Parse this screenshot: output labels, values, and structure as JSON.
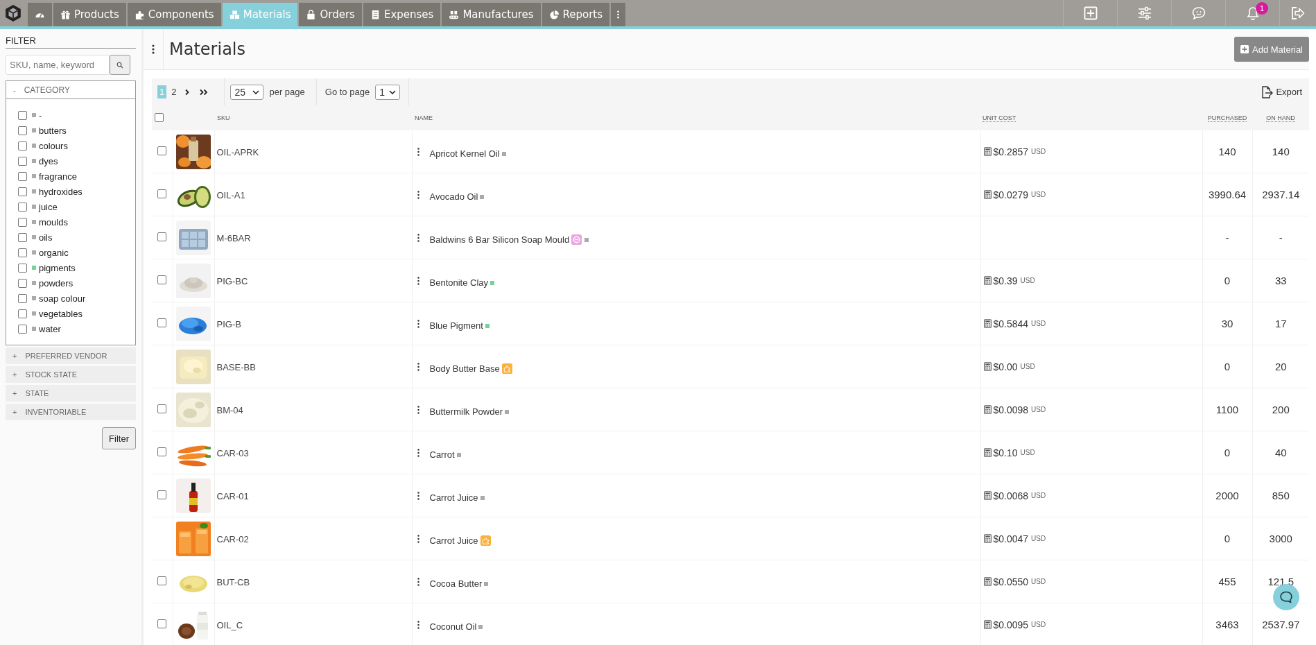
{
  "nav": {
    "dashboard_selected": false,
    "tabs": [
      {
        "label": "Products",
        "selected": false
      },
      {
        "label": "Components",
        "selected": false
      },
      {
        "label": "Materials",
        "selected": true
      },
      {
        "label": "Orders",
        "selected": false
      },
      {
        "label": "Expenses",
        "selected": false
      },
      {
        "label": "Manufactures",
        "selected": false
      },
      {
        "label": "Reports",
        "selected": false
      }
    ],
    "notifications": "1"
  },
  "filter": {
    "title": "FILTER",
    "search_placeholder": "SKU, name, keyword",
    "sections": [
      {
        "label": "CATEGORY",
        "toggle": "-",
        "expanded": true,
        "items": [
          {
            "label": "-",
            "color": "#aaaaaa",
            "checked": false
          },
          {
            "label": "butters",
            "color": "#aaaaaa",
            "checked": false
          },
          {
            "label": "colours",
            "color": "#aaaaaa",
            "checked": false
          },
          {
            "label": "dyes",
            "color": "#aaaaaa",
            "checked": false
          },
          {
            "label": "fragrance",
            "color": "#aaaaaa",
            "checked": false
          },
          {
            "label": "hydroxides",
            "color": "#aaaaaa",
            "checked": false
          },
          {
            "label": "juice",
            "color": "#aaaaaa",
            "checked": false
          },
          {
            "label": "moulds",
            "color": "#aaaaaa",
            "checked": false
          },
          {
            "label": "oils",
            "color": "#aaaaaa",
            "checked": false
          },
          {
            "label": "organic",
            "color": "#aaaaaa",
            "checked": false
          },
          {
            "label": "pigments",
            "color": "#77d09a",
            "checked": false
          },
          {
            "label": "powders",
            "color": "#aaaaaa",
            "checked": false
          },
          {
            "label": "soap colour",
            "color": "#aaaaaa",
            "checked": false
          },
          {
            "label": "vegetables",
            "color": "#aaaaaa",
            "checked": false
          },
          {
            "label": "water",
            "color": "#aaaaaa",
            "checked": false
          }
        ]
      },
      {
        "label": "PREFERRED VENDOR",
        "toggle": "+",
        "expanded": false
      },
      {
        "label": "STOCK STATE",
        "toggle": "+",
        "expanded": false
      },
      {
        "label": "STATE",
        "toggle": "+",
        "expanded": false
      },
      {
        "label": "INVENTORIABLE",
        "toggle": "+",
        "expanded": false
      }
    ],
    "button": "Filter"
  },
  "page": {
    "title": "Materials",
    "add_button": "Add Material"
  },
  "toolbar": {
    "pages": [
      {
        "label": "1",
        "selected": true
      },
      {
        "label": "2",
        "selected": false
      }
    ],
    "per_page": "25",
    "per_page_label": "per page",
    "goto_label": "Go to page",
    "goto_value": "1",
    "export": "Export"
  },
  "table": {
    "header_checked": false,
    "columns": [
      "SKU",
      "NAME",
      "UNIT COST",
      "PURCHASED",
      "ON HAND"
    ],
    "rows": [
      {
        "checked": false,
        "kind": "plain",
        "sku": "OIL-APRK",
        "name": "Apricot Kernel Oil",
        "color": "#aaaaaa",
        "cost": "$0.2857",
        "currency": "USD",
        "purchased": "140",
        "on_hand": "140"
      },
      {
        "checked": false,
        "kind": "plain",
        "sku": "OIL-A1",
        "name": "Avocado Oil",
        "color": "#aaaaaa",
        "cost": "$0.0279",
        "currency": "USD",
        "purchased": "3990.64",
        "on_hand": "2937.14"
      },
      {
        "checked": false,
        "kind": "blocked",
        "sku": "M-6BAR",
        "name": "Baldwins 6 Bar Silicon Soap Mould",
        "color": "#aaaaaa",
        "purchased": "-",
        "on_hand": "-"
      },
      {
        "checked": false,
        "kind": "plain",
        "sku": "PIG-BC",
        "name": "Bentonite Clay",
        "color": "#77d09a",
        "cost": "$0.39",
        "currency": "USD",
        "purchased": "0",
        "on_hand": "33"
      },
      {
        "checked": false,
        "kind": "plain",
        "sku": "PIG-B",
        "name": "Blue Pigment",
        "color": "#77d09a",
        "cost": "$0.5844",
        "currency": "USD",
        "purchased": "30",
        "on_hand": "17"
      },
      {
        "kind": "component",
        "sku": "BASE-BB",
        "name": "Body Butter Base",
        "cost": "$0.00",
        "currency": "USD",
        "purchased": "0",
        "on_hand": "20"
      },
      {
        "checked": false,
        "kind": "plain",
        "sku": "BM-04",
        "name": "Buttermilk Powder",
        "color": "#aaaaaa",
        "cost": "$0.0098",
        "currency": "USD",
        "purchased": "1100",
        "on_hand": "200"
      },
      {
        "checked": false,
        "kind": "plain",
        "sku": "CAR-03",
        "name": "Carrot",
        "color": "#aaaaaa",
        "cost": "$0.10",
        "currency": "USD",
        "purchased": "0",
        "on_hand": "40"
      },
      {
        "checked": false,
        "kind": "plain",
        "sku": "CAR-01",
        "name": "Carrot Juice",
        "color": "#aaaaaa",
        "cost": "$0.0068",
        "currency": "USD",
        "purchased": "2000",
        "on_hand": "850"
      },
      {
        "kind": "component",
        "sku": "CAR-02",
        "name": "Carrot Juice",
        "cost": "$0.0047",
        "currency": "USD",
        "purchased": "0",
        "on_hand": "3000"
      },
      {
        "checked": false,
        "kind": "plain",
        "sku": "BUT-CB",
        "name": "Cocoa Butter",
        "color": "#aaaaaa",
        "cost": "$0.0550",
        "currency": "USD",
        "purchased": "455",
        "on_hand": "121.5"
      },
      {
        "checked": false,
        "kind": "plain",
        "sku": "OIL_C",
        "name": "Coconut Oil",
        "color": "#aaaaaa",
        "cost": "$0.0095",
        "currency": "USD",
        "purchased": "3463",
        "on_hand": "2537.97"
      }
    ]
  }
}
